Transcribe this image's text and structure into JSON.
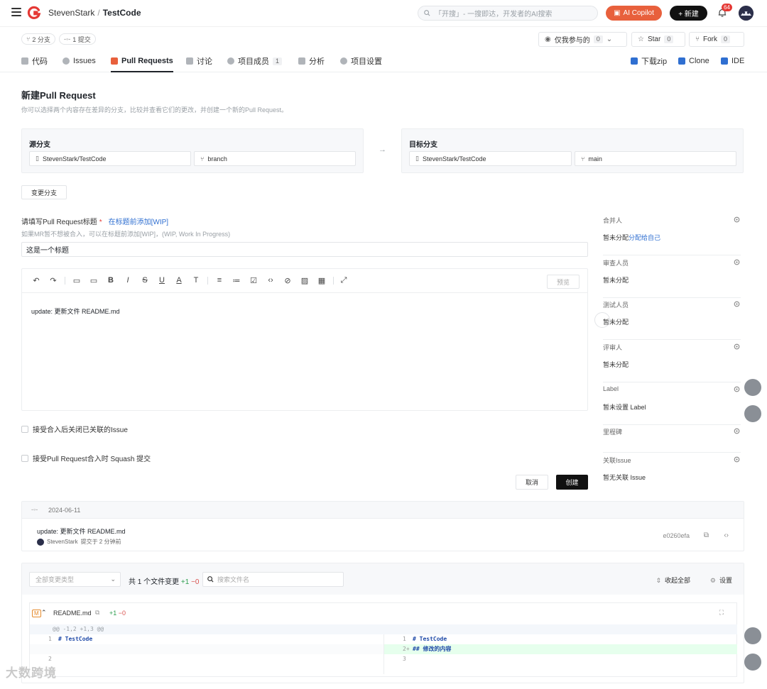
{
  "header": {
    "owner": "StevenStark",
    "separator": "/",
    "repo": "TestCode",
    "search_placeholder": "「开搜」- 一搜即达，开发者的AI搜索",
    "ai_label": "AI Copilot",
    "new_label": "+ 新建",
    "notif_count": "64"
  },
  "repo_bar": {
    "branches": "2 分支",
    "commits": "1 提交",
    "watch_label": "仅我参与的",
    "watch_count": "0",
    "star_label": "Star",
    "star_count": "0",
    "fork_label": "Fork",
    "fork_count": "0"
  },
  "tabs": {
    "code": "代码",
    "issues": "Issues",
    "pull_requests": "Pull Requests",
    "discuss": "讨论",
    "members": "项目成员",
    "members_count": "1",
    "analysis": "分析",
    "settings": "项目设置",
    "download": "下载zip",
    "clone": "Clone",
    "ide": "IDE"
  },
  "page": {
    "title": "新建Pull Request",
    "subtitle": "你可以选择两个内容存在差异的分支，比较并查看它们的更改，并创建一个新的Pull Request。"
  },
  "source": {
    "label": "源分支",
    "repo": "StevenStark/TestCode",
    "branch": "branch"
  },
  "target": {
    "label": "目标分支",
    "repo": "StevenStark/TestCode",
    "branch": "main"
  },
  "change_branch_label": "变更分支",
  "form": {
    "title_label": "请填写Pull Request标题",
    "required_mark": "*",
    "wip_link": "在标题前添加[WIP]",
    "hint": "如果MR暂不想被合入，可以在标题前添加[WIP]，(WIP, Work In Progress)",
    "title_value": "这是一个标题",
    "preview_label": "预览",
    "body": "update: 更新文件 README.md",
    "close_issue_label": "接受合入后关闭已关联的Issue",
    "squash_label": "接受Pull Request合入时 Squash 提交",
    "cancel_label": "取消",
    "create_label": "创建"
  },
  "sidebar": [
    {
      "title": "合并人",
      "value": "暂未分配",
      "link": "分配给自己"
    },
    {
      "title": "审查人员",
      "value": "暂未分配",
      "link": ""
    },
    {
      "title": "测试人员",
      "value": "暂未分配",
      "link": ""
    },
    {
      "title": "评审人",
      "value": "暂未分配",
      "link": ""
    },
    {
      "title": "Label",
      "value": "暂未设置 Label",
      "link": ""
    },
    {
      "title": "里程碑",
      "value": "",
      "link": ""
    },
    {
      "title": "关联Issue",
      "value": "暂无关联 Issue",
      "link": ""
    }
  ],
  "commit": {
    "date": "2024-06-11",
    "message": "update: 更新文件 README.md",
    "author": "StevenStark",
    "time": "提交于 2 分钟前",
    "sha": "e0260efa"
  },
  "changes": {
    "type_placeholder": "全部变更类型",
    "count_label": "共 1 个文件变更",
    "plus": "+1",
    "minus": "−0",
    "search_placeholder": "搜索文件名",
    "collapse_all": "收起全部",
    "settings": "设置",
    "file": {
      "badge": "M",
      "name": "README.md",
      "plus": "+1",
      "minus": "−0",
      "hunk": "@@ -1,2 +1,3 @@",
      "left": [
        {
          "n": "1",
          "code": "# TestCode",
          "kind": "ctx"
        },
        {
          "n": "",
          "code": "",
          "kind": "empty"
        },
        {
          "n": "2",
          "code": "",
          "kind": "ctx"
        }
      ],
      "right": [
        {
          "n": "1",
          "code": "# TestCode",
          "kind": "ctx"
        },
        {
          "n": "2+",
          "code": "## 修改的内容",
          "kind": "add"
        },
        {
          "n": "3",
          "code": "",
          "kind": "ctx"
        }
      ]
    }
  },
  "watermark": "大数跨境",
  "colors": {
    "accent": "#e8603c",
    "primary_btn": "#111111",
    "link": "#2f6fd1",
    "add_bg": "#e6ffed"
  }
}
